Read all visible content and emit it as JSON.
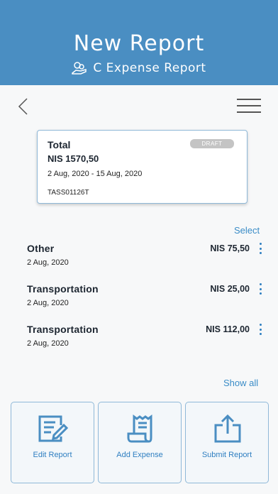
{
  "header": {
    "title": "New Report",
    "subtitle": "C Expense  Report",
    "subtitle_icon": "coins-hand-icon"
  },
  "nav": {
    "back_icon": "chevron-left-icon",
    "menu_icon": "hamburger-menu-icon"
  },
  "summary": {
    "label": "Total",
    "amount": "NIS 1570,50",
    "badge": "DRAFT",
    "dates": "2 Aug, 2020 - 15 Aug, 2020",
    "ref": "TASS01126T"
  },
  "list": {
    "select_label": "Select",
    "show_all_label": "Show all",
    "items": [
      {
        "category": "Other",
        "date": "2 Aug, 2020",
        "amount": "NIS 75,50"
      },
      {
        "category": "Transportation",
        "date": "2 Aug, 2020",
        "amount": "NIS 25,00"
      },
      {
        "category": "Transportation",
        "date": "2 Aug, 2020",
        "amount": "NIS 112,00"
      }
    ]
  },
  "actions": {
    "edit_label": "Edit Report",
    "add_label": "Add  Expense",
    "submit_label": "Submit Report"
  },
  "colors": {
    "header_bg": "#4a8ec2",
    "accent": "#3a8cc7",
    "badge_bg": "#c4c4c4"
  }
}
